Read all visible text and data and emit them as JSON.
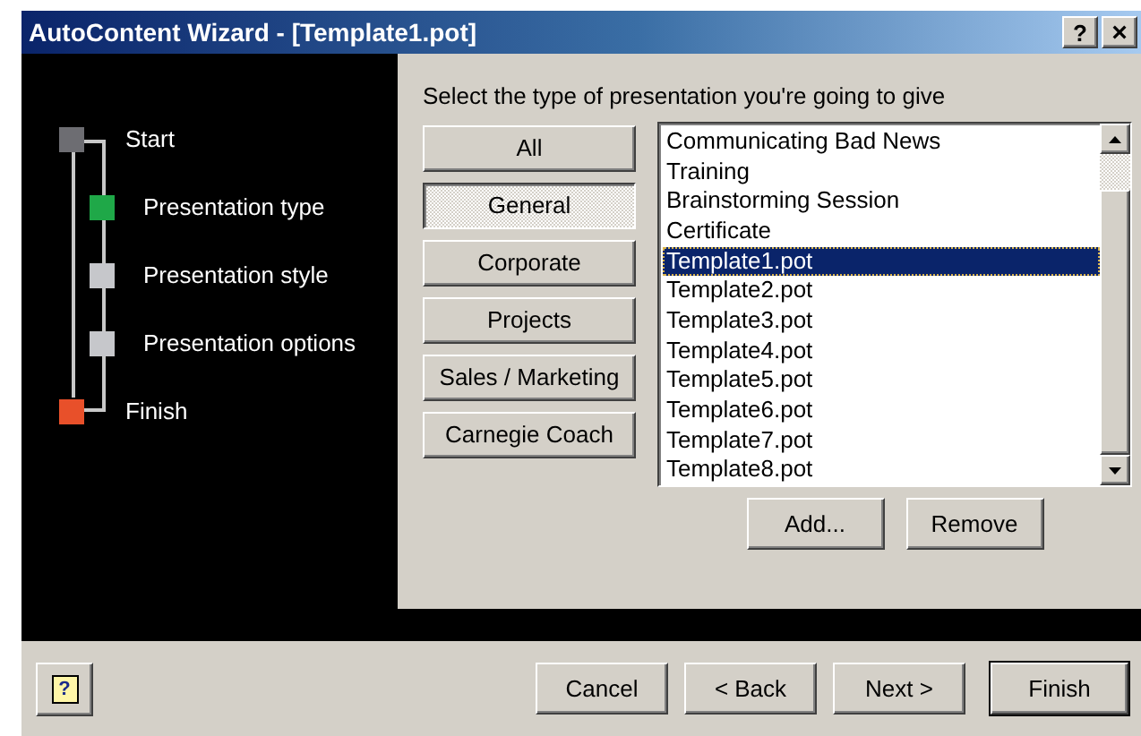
{
  "window": {
    "title": "AutoContent Wizard - [Template1.pot]",
    "help_glyph": "?",
    "close_glyph": "×"
  },
  "steps": [
    {
      "label": "Start",
      "color": "#6d6d72",
      "children": [
        {
          "label": "Presentation type",
          "color": "#1fa848"
        },
        {
          "label": "Presentation style",
          "color": "#c6c7cb"
        },
        {
          "label": "Presentation options",
          "color": "#c6c7cb"
        }
      ]
    },
    {
      "label": "Finish",
      "color": "#e8502a"
    }
  ],
  "prompt": "Select the type of presentation you're going to give",
  "categories": [
    {
      "label": "All",
      "selected": false
    },
    {
      "label": "General",
      "selected": true
    },
    {
      "label": "Corporate",
      "selected": false
    },
    {
      "label": "Projects",
      "selected": false
    },
    {
      "label": "Sales / Marketing",
      "selected": false
    },
    {
      "label": "Carnegie Coach",
      "selected": false
    }
  ],
  "templates": [
    {
      "label": "Communicating Bad News",
      "selected": false
    },
    {
      "label": "Training",
      "selected": false
    },
    {
      "label": "Brainstorming Session",
      "selected": false
    },
    {
      "label": "Certificate",
      "selected": false
    },
    {
      "label": "Template1.pot",
      "selected": true
    },
    {
      "label": "Template2.pot",
      "selected": false
    },
    {
      "label": "Template3.pot",
      "selected": false
    },
    {
      "label": "Template4.pot",
      "selected": false
    },
    {
      "label": "Template5.pot",
      "selected": false
    },
    {
      "label": "Template6.pot",
      "selected": false
    },
    {
      "label": "Template7.pot",
      "selected": false
    },
    {
      "label": "Template8.pot",
      "selected": false
    }
  ],
  "list_buttons": [
    "Add...",
    "Remove"
  ],
  "help_button_glyph": "?",
  "footer_buttons": [
    {
      "label": "Cancel",
      "default": false
    },
    {
      "label": "< Back",
      "default": false
    },
    {
      "label": "Next >",
      "default": false
    },
    {
      "label": "Finish",
      "default": true
    }
  ]
}
